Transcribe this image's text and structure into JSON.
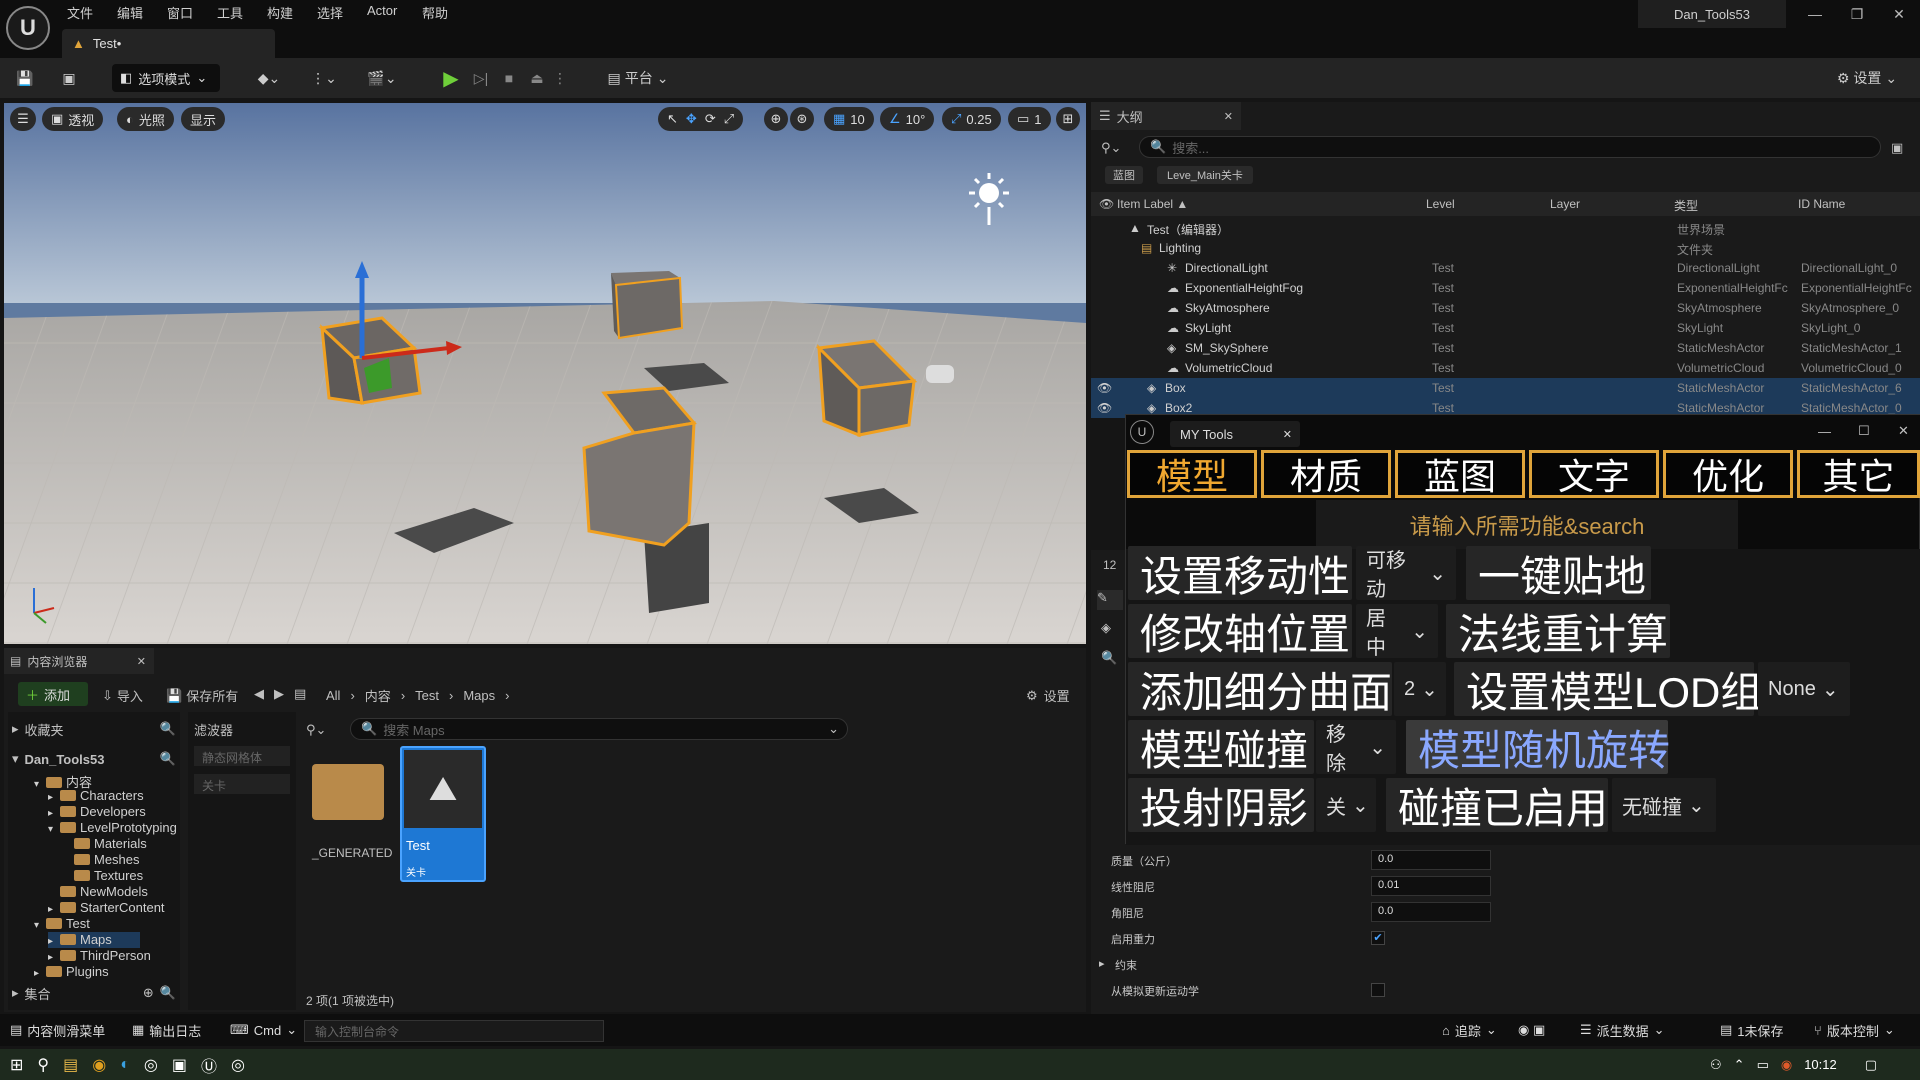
{
  "app": {
    "logo": "U",
    "project": "Dan_Tools53",
    "doc_tab": "Test•"
  },
  "menu": [
    "文件",
    "编辑",
    "窗口",
    "工具",
    "构建",
    "选择",
    "Actor",
    "帮助"
  ],
  "toolbar": {
    "mode": "选项模式",
    "platform": "平台",
    "settings": "设置"
  },
  "viewport": {
    "perspective": "透视",
    "lighting": "光照",
    "show": "显示",
    "grid": "10",
    "angle": "10°",
    "scale": "0.25",
    "camera": "1"
  },
  "outliner": {
    "tab": "大纲",
    "search_placeholder": "搜索...",
    "chips": [
      "蓝图",
      "Leve_Main关卡"
    ],
    "columns": [
      "Item Label ▲",
      "Level",
      "Layer",
      "类型",
      "ID Name"
    ],
    "rows": [
      {
        "label": "Test（编辑器）",
        "level": "",
        "type": "世界场景",
        "id": ""
      },
      {
        "label": "Lighting",
        "level": "",
        "type": "文件夹",
        "id": ""
      },
      {
        "label": "DirectionalLight",
        "level": "Test",
        "type": "DirectionalLight",
        "id": "DirectionalLight_0"
      },
      {
        "label": "ExponentialHeightFog",
        "level": "Test",
        "type": "ExponentialHeightFc",
        "id": "ExponentialHeightFc"
      },
      {
        "label": "SkyAtmosphere",
        "level": "Test",
        "type": "SkyAtmosphere",
        "id": "SkyAtmosphere_0"
      },
      {
        "label": "SkyLight",
        "level": "Test",
        "type": "SkyLight",
        "id": "SkyLight_0"
      },
      {
        "label": "SM_SkySphere",
        "level": "Test",
        "type": "StaticMeshActor",
        "id": "StaticMeshActor_1"
      },
      {
        "label": "VolumetricCloud",
        "level": "Test",
        "type": "VolumetricCloud",
        "id": "VolumetricCloud_0"
      },
      {
        "label": "Box",
        "level": "Test",
        "type": "StaticMeshActor",
        "id": "StaticMeshActor_6"
      },
      {
        "label": "Box2",
        "level": "Test",
        "type": "StaticMeshActor",
        "id": "StaticMeshActor_0"
      }
    ]
  },
  "tools": {
    "tab": "MY Tools",
    "categories": [
      "模型",
      "材质",
      "蓝图",
      "文字",
      "优化",
      "其它"
    ],
    "search": "请输入所需功能&search",
    "rows": {
      "r1": {
        "a": "设置移动性",
        "dd": "可移动",
        "b": "一键贴地"
      },
      "r2": {
        "a": "修改轴位置",
        "dd": "居中",
        "b": "法线重计算"
      },
      "r3": {
        "a": "添加细分曲面",
        "dd": "2",
        "b": "设置模型LOD组",
        "dd2": "None"
      },
      "r4": {
        "a": "模型碰撞",
        "dd": "移除",
        "b": "模型随机旋转"
      },
      "r5": {
        "a": "投射阴影",
        "dd": "关",
        "b": "碰撞已启用",
        "dd2": "无碰撞"
      }
    },
    "side_number": "12"
  },
  "details": {
    "rows": [
      {
        "label": "质量（公斤）",
        "value": "0.0"
      },
      {
        "label": "线性阻尼",
        "value": "0.01"
      },
      {
        "label": "角阻尼",
        "value": "0.0"
      },
      {
        "label": "启用重力",
        "value": "✔"
      },
      {
        "label": "约束",
        "value": ""
      },
      {
        "label": "从模拟更新运动学",
        "value": ""
      }
    ]
  },
  "content_browser": {
    "tab": "内容浏览器",
    "add": "添加",
    "import": "导入",
    "save_all": "保存所有",
    "path": [
      "All",
      "内容",
      "Test",
      "Maps"
    ],
    "settings": "设置",
    "favorites": "收藏夹",
    "project": "Dan_Tools53",
    "collections": "集合",
    "filters": "滤波器",
    "filter_items": [
      "静态网格体",
      "关卡"
    ],
    "search_placeholder": "搜索 Maps",
    "tree": [
      "内容",
      "Characters",
      "Developers",
      "LevelPrototyping",
      "Materials",
      "Meshes",
      "Textures",
      "NewModels",
      "StarterContent",
      "Test",
      "Maps",
      "ThirdPerson",
      "Plugins"
    ],
    "assets": [
      {
        "name": "_GENERATED",
        "type": ""
      },
      {
        "name": "Test",
        "type": "关卡"
      }
    ],
    "status": "2 项(1 项被选中)"
  },
  "statusbar": {
    "drawer": "内容侧滑菜单",
    "log": "输出日志",
    "cmd": "Cmd",
    "console_placeholder": "输入控制台命令",
    "trace": "追踪",
    "derived": "派生数据",
    "unsaved": "1未保存",
    "source": "版本控制"
  },
  "taskbar": {
    "time": "10:12"
  }
}
